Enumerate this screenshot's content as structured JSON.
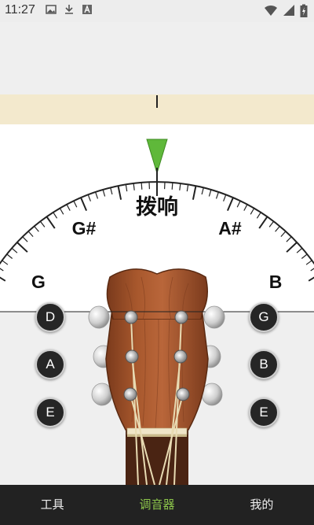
{
  "status_bar": {
    "time": "11:27",
    "left_icons": [
      "image-icon",
      "download-icon",
      "text-a-icon"
    ],
    "right_icons": [
      "wifi-icon",
      "signal-icon",
      "battery-charging-icon"
    ]
  },
  "tuner": {
    "action_label": "拨响",
    "fine_needle_offset": 0,
    "pointer_color": "#5fb83a",
    "notes": {
      "upper_left": "G#",
      "upper_right": "A#",
      "lower_left": "G",
      "lower_right": "B"
    }
  },
  "strings": {
    "left": [
      "D",
      "A",
      "E"
    ],
    "right": [
      "G",
      "B",
      "E"
    ]
  },
  "bottom_nav": {
    "tabs": [
      {
        "label": "工具",
        "active": false
      },
      {
        "label": "调音器",
        "active": true
      },
      {
        "label": "我的",
        "active": false
      }
    ]
  },
  "colors": {
    "accent": "#8bc34a",
    "fine_strip": "#f3e9cd",
    "headstock": "#a0522d"
  }
}
